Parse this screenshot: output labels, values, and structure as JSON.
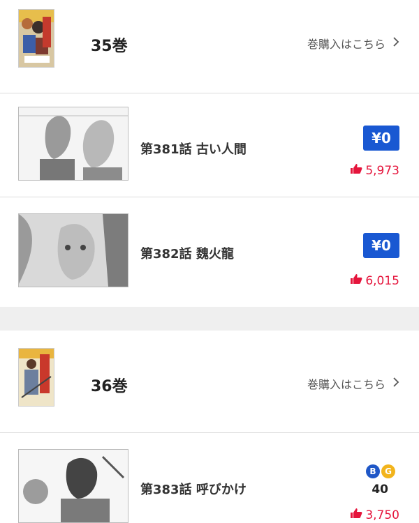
{
  "volumes": [
    {
      "label": "35巻",
      "buy_label": "巻購入はこちら",
      "episodes": [
        {
          "title": "第381話 古い人間",
          "price_badge": "¥0",
          "likes": "5,973"
        },
        {
          "title": "第382話 魏火龍",
          "price_badge": "¥0",
          "likes": "6,015"
        }
      ]
    },
    {
      "label": "36巻",
      "buy_label": "巻購入はこちら",
      "episodes": [
        {
          "title": "第383話 呼びかけ",
          "coins": [
            "B",
            "G"
          ],
          "coin_price": "40",
          "likes": "3,750"
        }
      ]
    }
  ],
  "colors": {
    "accent_blue": "#1958d2",
    "like_red": "#e5153c",
    "coin_blue": "#1f57c7",
    "coin_gold": "#f2b41c"
  },
  "icons": {
    "chevron": "chevron-right-icon",
    "like": "thumbs-up-icon"
  }
}
